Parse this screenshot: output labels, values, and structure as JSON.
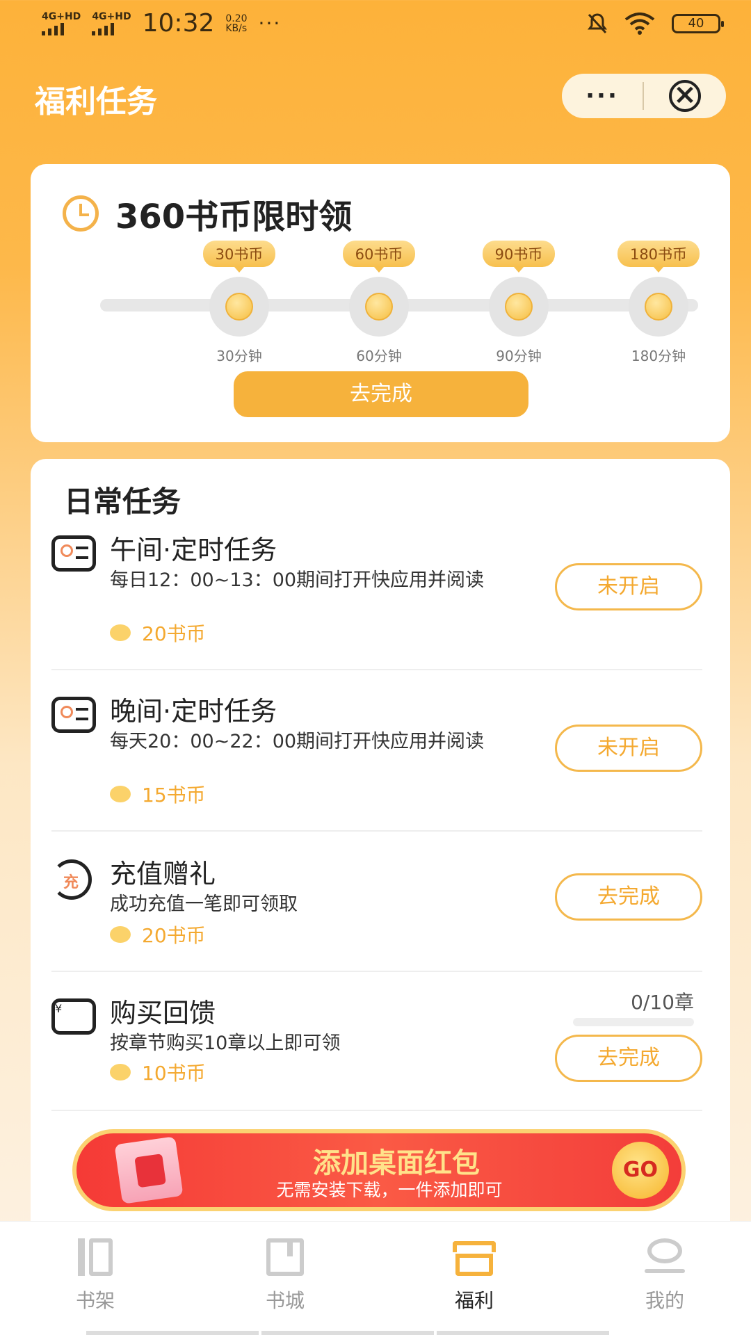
{
  "status_bar": {
    "sim1": "4G+HD",
    "sim2": "4G+HD",
    "time": "10:32",
    "speed_value": "0.20",
    "speed_unit": "KB/s",
    "more": "···",
    "battery": "40"
  },
  "header": {
    "title": "福利任务",
    "more": "···"
  },
  "timed_reward": {
    "title": "360书币限时领",
    "milestones": [
      {
        "coins": "30书币",
        "time": "30分钟"
      },
      {
        "coins": "60书币",
        "time": "60分钟"
      },
      {
        "coins": "90书币",
        "time": "90分钟"
      },
      {
        "coins": "180书币",
        "time": "180分钟"
      }
    ],
    "button": "去完成"
  },
  "daily": {
    "title": "日常任务",
    "tasks": [
      {
        "name": "午间·定时任务",
        "desc": "每日12：00~13：00期间打开快应用并阅读",
        "reward": "20书币",
        "button": "未开启"
      },
      {
        "name": "晚间·定时任务",
        "desc": "每天20：00~22：00期间打开快应用并阅读",
        "reward": "15书币",
        "button": "未开启"
      },
      {
        "name": "充值赠礼",
        "desc": "成功充值一笔即可领取",
        "reward": "20书币",
        "button": "去完成"
      },
      {
        "name": "购买回馈",
        "desc": "按章节购买10章以上即可领",
        "reward": "10书币",
        "button": "去完成",
        "progress": "0/10章",
        "progress_fraction": 0
      }
    ],
    "icon_charge": "充",
    "icon_yen": "¥"
  },
  "banner": {
    "title": "添加桌面红包",
    "subtitle": "无需安装下载，一件添加即可",
    "go": "GO"
  },
  "nav": {
    "items": [
      {
        "label": "书架",
        "icon": "bookshelf-icon"
      },
      {
        "label": "书城",
        "icon": "bookstore-icon"
      },
      {
        "label": "福利",
        "icon": "welfare-icon"
      },
      {
        "label": "我的",
        "icon": "profile-icon"
      }
    ]
  },
  "colors": {
    "primary": "#f6b23c",
    "accent_text": "#f4a930",
    "banner_red": "#f53a36"
  }
}
